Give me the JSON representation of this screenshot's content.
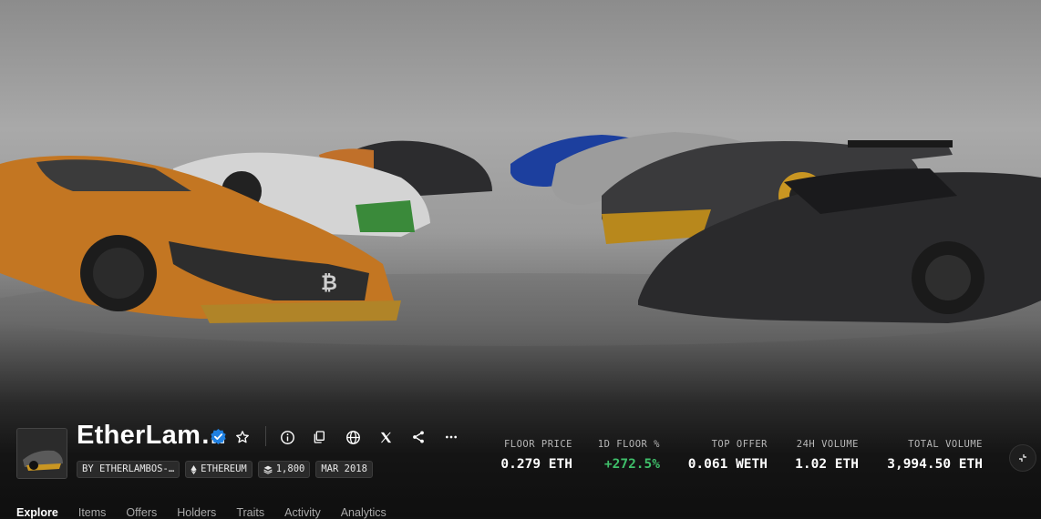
{
  "collection": {
    "title": "EtherLam…",
    "creator_tag": "BY ETHERLAMBOS-…",
    "chain_tag": "ETHEREUM",
    "items_tag": "1,800",
    "date_tag": "MAR 2018"
  },
  "stats": {
    "floor_price": {
      "label": "FLOOR PRICE",
      "value": "0.279 ETH"
    },
    "floor_change": {
      "label": "1D FLOOR %",
      "value": "+272.5%"
    },
    "top_offer": {
      "label": "TOP OFFER",
      "value": "0.061 WETH"
    },
    "volume_24h": {
      "label": "24H VOLUME",
      "value": "1.02 ETH"
    },
    "total_volume": {
      "label": "TOTAL VOLUME",
      "value": "3,994.50 ETH"
    }
  },
  "tabs": [
    "Explore",
    "Items",
    "Offers",
    "Holders",
    "Traits",
    "Activity",
    "Analytics"
  ],
  "colors": {
    "positive": "#3fbf6a",
    "verified": "#2081e2",
    "background": "#111111"
  },
  "icons": [
    "verified-icon",
    "star-icon",
    "info-icon",
    "copy-icon",
    "globe-icon",
    "x-icon",
    "share-icon",
    "more-icon",
    "ethereum-icon",
    "layers-icon",
    "collapse-icon"
  ]
}
